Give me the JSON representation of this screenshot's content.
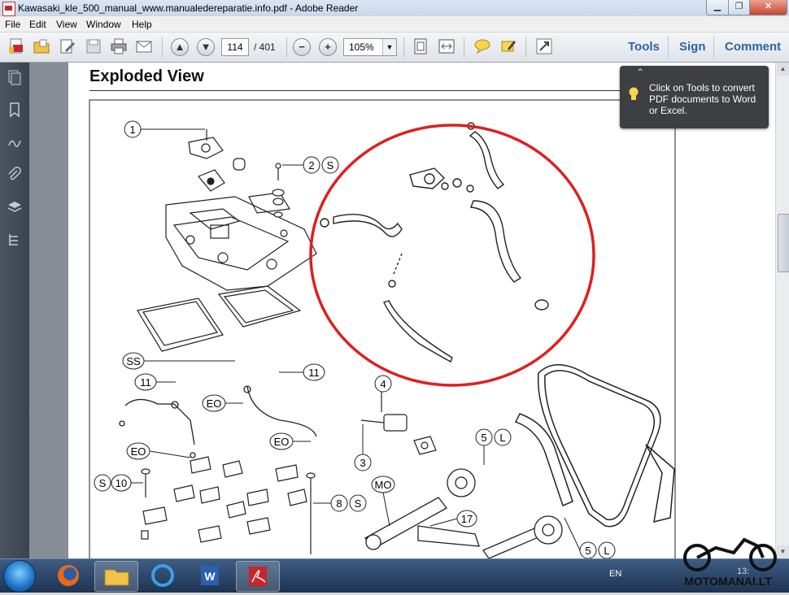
{
  "window": {
    "title": "Kawasaki_kle_500_manual_www.manualedereparatie.info.pdf - Adobe Reader",
    "controls": {
      "minimize": "▁",
      "maximize": "❐",
      "close": "✕"
    }
  },
  "menu": [
    "File",
    "Edit",
    "View",
    "Window",
    "Help"
  ],
  "toolbar": {
    "icons": [
      "create-pdf-icon",
      "open-icon",
      "edit-icon",
      "save-icon",
      "print-icon",
      "email-icon",
      "prev-page-icon",
      "next-page-icon",
      "zoom-out-icon",
      "zoom-in-icon",
      "fit-page-icon",
      "fit-width-icon",
      "comment-icon",
      "highlight-icon",
      "fullscreen-icon"
    ],
    "page_current": "114",
    "page_total": "/ 401",
    "zoom": "105%",
    "links": {
      "tools": "Tools",
      "sign": "Sign",
      "comment": "Comment"
    }
  },
  "nav_pane": {
    "icons": [
      "pages-icon",
      "bookmarks-icon",
      "signatures-icon",
      "attachments-icon",
      "layers-icon",
      "model-tree-icon"
    ]
  },
  "document": {
    "heading": "Exploded View",
    "callouts": [
      {
        "num": "1",
        "code": ""
      },
      {
        "num": "2",
        "code": "S"
      },
      {
        "num": "SS",
        "code": ""
      },
      {
        "num": "11",
        "code": ""
      },
      {
        "num": "11",
        "code": ""
      },
      {
        "num": "EO",
        "code": ""
      },
      {
        "num": "EO",
        "code": ""
      },
      {
        "num": "EO",
        "code": ""
      },
      {
        "num": "4",
        "code": ""
      },
      {
        "num": "3",
        "code": ""
      },
      {
        "num": "5",
        "code": "L"
      },
      {
        "num": "S",
        "code": "10"
      },
      {
        "num": "8",
        "code": "S"
      },
      {
        "num": "MO",
        "code": ""
      },
      {
        "num": "17",
        "code": ""
      },
      {
        "num": "5",
        "code": "L"
      }
    ]
  },
  "tooltip": {
    "text": "Click on Tools to convert PDF documents to Word or Excel."
  },
  "taskbar": {
    "language": "EN",
    "clock_partial": "13:",
    "watermark": "MOTOMANAI.LT"
  },
  "colors": {
    "accent": "#2e63a6",
    "highlight_circle": "#e01e1e",
    "tooltip_bg": "#3d3f42"
  }
}
